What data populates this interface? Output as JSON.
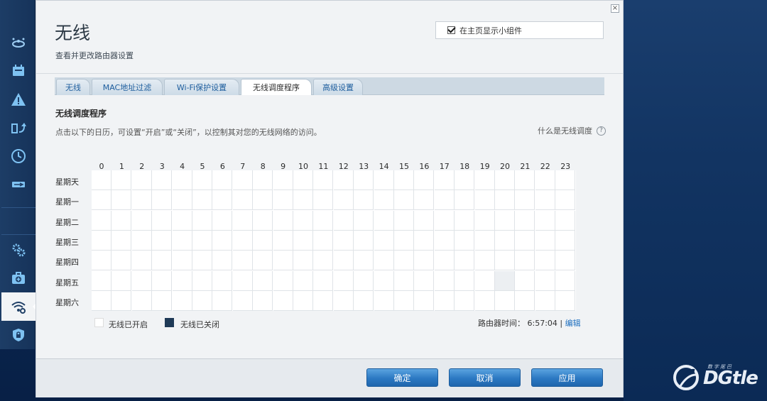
{
  "page": {
    "title": "无线",
    "subtitle": "查看并更改路由器设置",
    "show_widget_label": "在主页显示小组件",
    "show_widget_checked": true
  },
  "tabs": [
    {
      "label": "无线",
      "active": false
    },
    {
      "label": "MAC地址过滤",
      "active": false
    },
    {
      "label": "Wi-Fi保护设置",
      "active": false
    },
    {
      "label": "无线调度程序",
      "active": true
    },
    {
      "label": "高级设置",
      "active": false
    }
  ],
  "scheduler": {
    "title": "无线调度程序",
    "description": "点击以下的日历，可设置“开启”或“关闭”，以控制其对您的无线网络的访问。",
    "help_link": "什么是无线调度",
    "hours": [
      "0",
      "1",
      "2",
      "3",
      "4",
      "5",
      "6",
      "7",
      "8",
      "9",
      "10",
      "11",
      "12",
      "13",
      "14",
      "15",
      "16",
      "17",
      "18",
      "19",
      "20",
      "21",
      "22",
      "23"
    ],
    "days": [
      "星期天",
      "星期一",
      "星期二",
      "星期三",
      "星期四",
      "星期五",
      "星期六"
    ],
    "legend_on": "无线已开启",
    "legend_off": "无线已关闭",
    "router_time_label": "路由器时间：",
    "router_time": "6:57:04",
    "separator": "|",
    "edit_label": "编辑"
  },
  "buttons": {
    "ok": "确定",
    "cancel": "取消",
    "apply": "应用"
  },
  "watermark": {
    "brand": "DGtle",
    "sub": "数字尾巴"
  },
  "colors": {
    "accent": "#1e6fbf",
    "button": "#2b78c2",
    "off": "#1f3a57"
  }
}
